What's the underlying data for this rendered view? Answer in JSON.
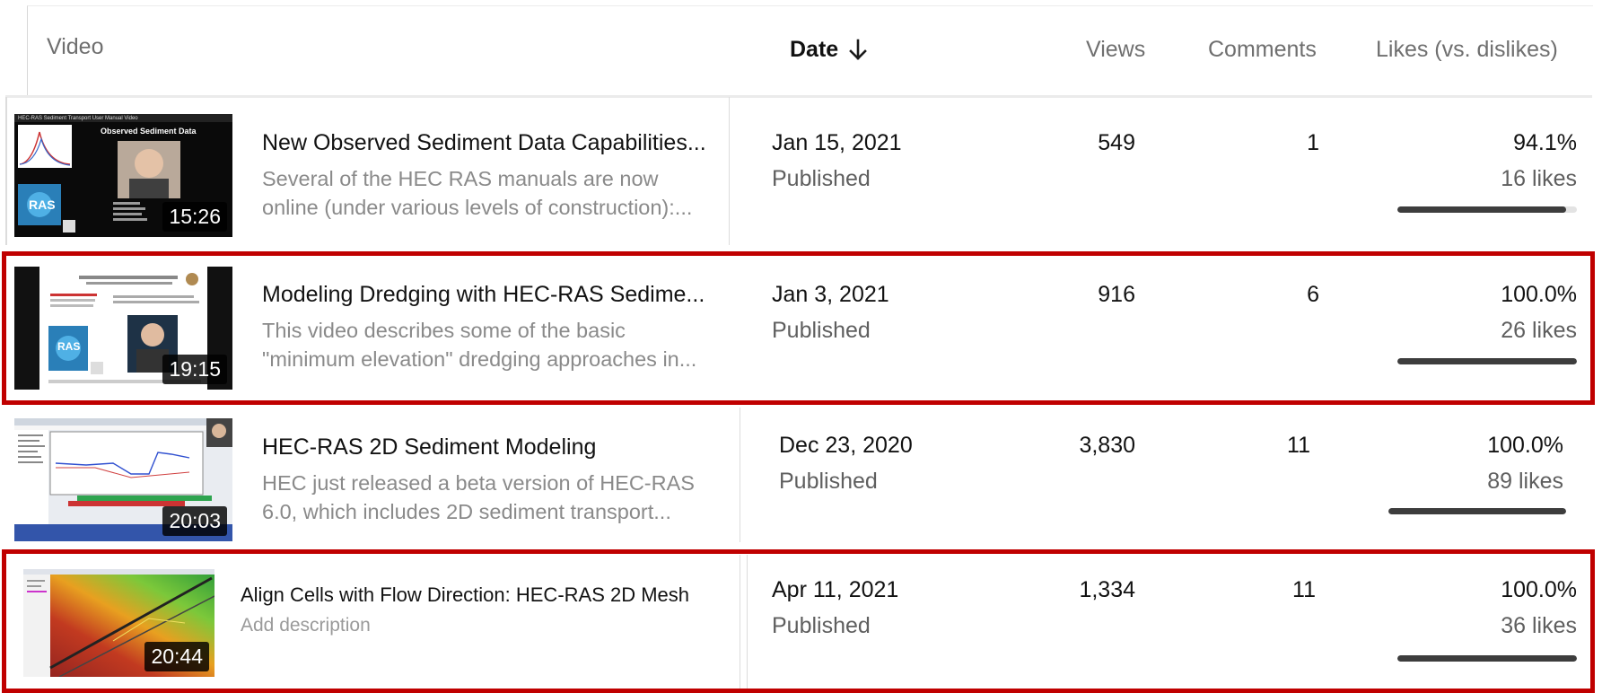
{
  "header": {
    "video": "Video",
    "date": "Date",
    "views": "Views",
    "comments": "Comments",
    "likes": "Likes (vs. dislikes)"
  },
  "rows": [
    {
      "title": "New Observed Sediment Data Capabilities...",
      "desc_line1": "Several of the HEC RAS manuals are now",
      "desc_line2": "online (under various levels of construction):...",
      "duration": "15:26",
      "date": "Jan 15, 2021",
      "status": "Published",
      "views": "549",
      "comments": "1",
      "like_pct": "94.1%",
      "likes": "16 likes",
      "like_fraction": 0.941,
      "thumb_title": "HEC-RAS Sediment Transport User Manual Video",
      "thumb_heading": "Observed Sediment Data",
      "thumb_logo": "RAS"
    },
    {
      "title": "Modeling Dredging with HEC-RAS Sedime...",
      "desc_line1": "This video describes some of the basic",
      "desc_line2": "\"minimum elevation\" dredging approaches in...",
      "duration": "19:15",
      "date": "Jan 3, 2021",
      "status": "Published",
      "views": "916",
      "comments": "6",
      "like_pct": "100.0%",
      "likes": "26 likes",
      "like_fraction": 1.0,
      "thumb_logo": "RAS"
    },
    {
      "title": "HEC-RAS 2D Sediment Modeling",
      "desc_line1": "HEC just released a beta version of HEC-RAS",
      "desc_line2": "6.0, which includes 2D sediment transport...",
      "duration": "20:03",
      "date": "Dec 23, 2020",
      "status": "Published",
      "views": "3,830",
      "comments": "11",
      "like_pct": "100.0%",
      "likes": "89 likes",
      "like_fraction": 1.0
    },
    {
      "title": "Align Cells with Flow Direction: HEC-RAS 2D Mesh",
      "desc_line1": "Add description",
      "duration": "20:44",
      "date": "Apr 11, 2021",
      "status": "Published",
      "views": "1,334",
      "comments": "11",
      "like_pct": "100.0%",
      "likes": "36 likes",
      "like_fraction": 1.0
    }
  ],
  "colors": {
    "highlight": "#c00000",
    "like_bar": "#3d3d3d",
    "like_track": "#e3e3e3"
  },
  "icons": {
    "sort": "arrow-down-icon"
  }
}
